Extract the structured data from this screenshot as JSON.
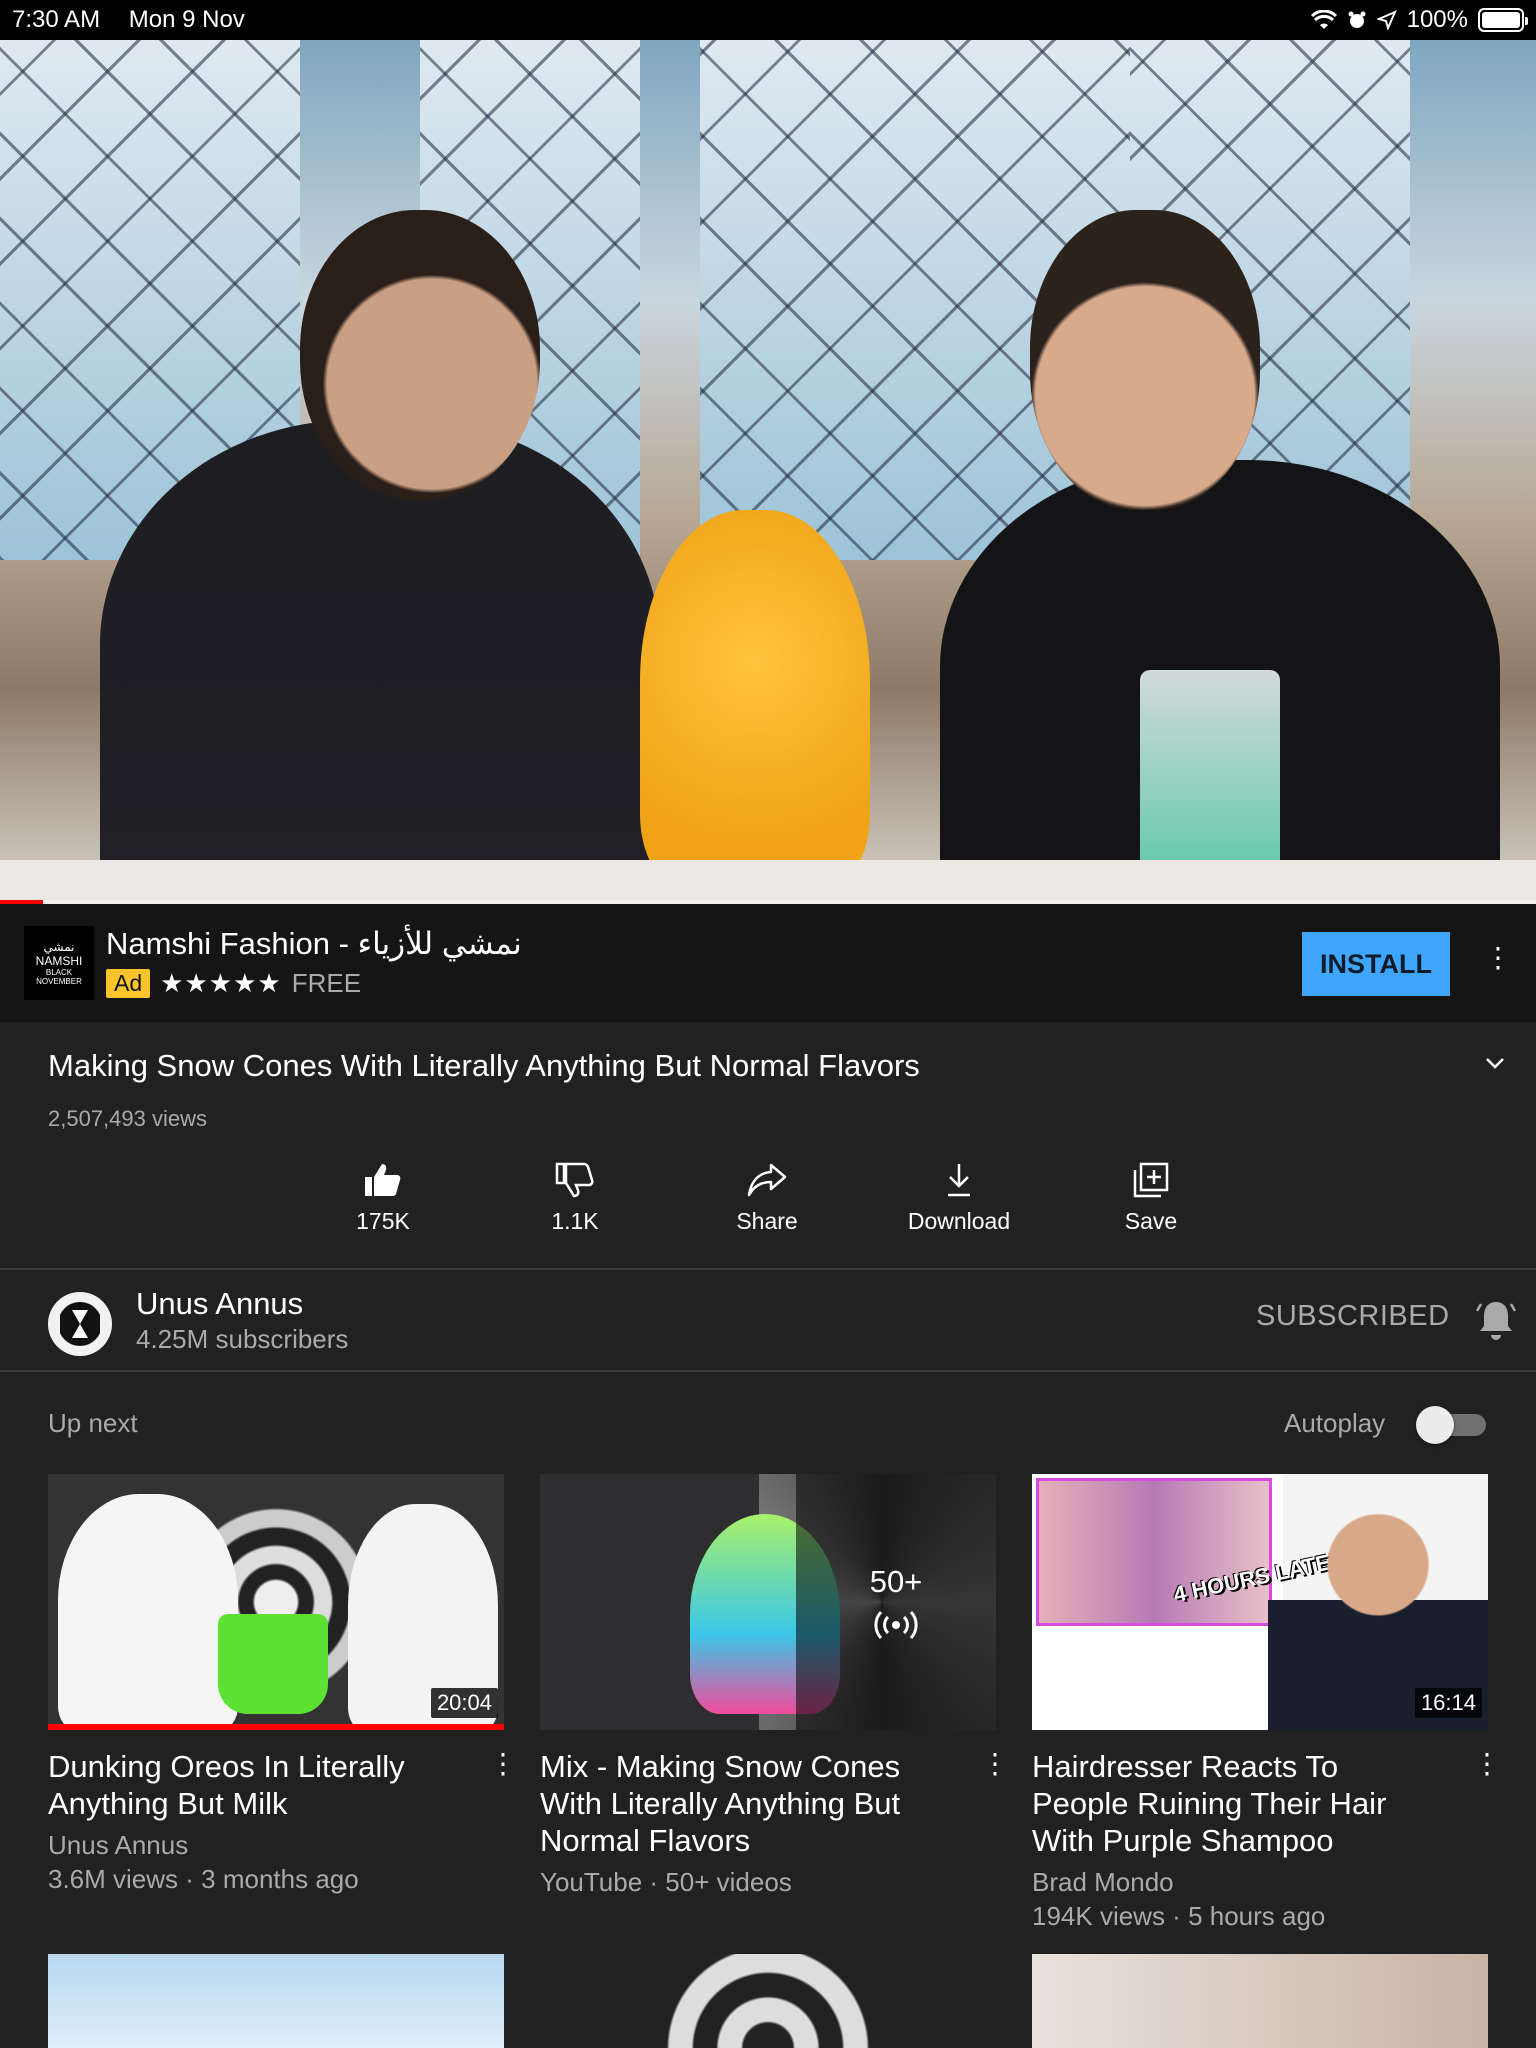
{
  "status": {
    "time": "7:30 AM",
    "date": "Mon 9 Nov",
    "battery": "100%"
  },
  "video": {
    "progress_fraction": 0.028
  },
  "ad": {
    "title": "Namshi Fashion - نمشي للأزياء",
    "badge": "Ad",
    "stars": "★★★★★",
    "rating": 4.5,
    "price": "FREE",
    "install_label": "INSTALL",
    "logo_top": "نمشي",
    "logo_name": "NAMSHI",
    "logo_sub1": "BLACK",
    "logo_sub2": "NOVEMBER"
  },
  "info": {
    "title": "Making Snow Cones With Literally Anything But Normal Flavors",
    "views": "2,507,493 views"
  },
  "actions": {
    "like": "175K",
    "dislike": "1.1K",
    "share": "Share",
    "download": "Download",
    "save": "Save"
  },
  "channel": {
    "name": "Unus Annus",
    "subscribers": "4.25M subscribers",
    "subscribed_label": "SUBSCRIBED"
  },
  "upnext": {
    "label": "Up next",
    "autoplay_label": "Autoplay",
    "autoplay_on": false
  },
  "cards": [
    {
      "title": "Dunking Oreos In Literally Anything But Milk",
      "channel": "Unus Annus",
      "meta": "3.6M views · 3 months ago",
      "duration": "20:04"
    },
    {
      "title": "Mix - Making Snow Cones With Literally Anything But Normal Flavors",
      "channel": "YouTube",
      "meta": "50+ videos",
      "playlist_count": "50+"
    },
    {
      "title": "Hairdresser Reacts To People Ruining Their Hair With Purple Shampoo",
      "channel": "Brad Mondo",
      "meta": "194K views · 5 hours ago",
      "duration": "16:14",
      "sticker": "4 HOURS LATER"
    }
  ]
}
